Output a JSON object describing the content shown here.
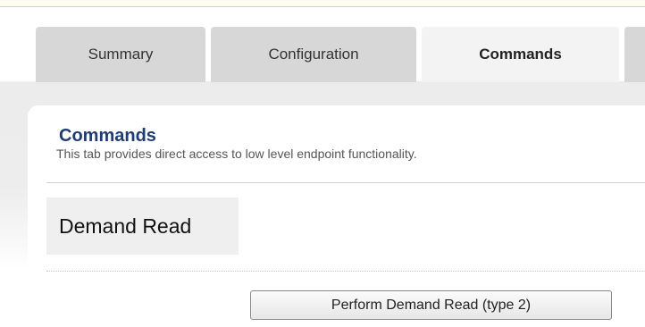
{
  "tabs": {
    "items": [
      {
        "label": "Summary"
      },
      {
        "label": "Configuration"
      },
      {
        "label": "Commands"
      },
      {
        "label": ""
      }
    ],
    "active": "Commands"
  },
  "commands": {
    "title": "Commands",
    "description": "This tab provides direct access to low level endpoint functionality.",
    "demand_read": {
      "heading": "Demand Read",
      "button_label": "Perform Demand Read (type 2)"
    }
  },
  "colors": {
    "accent_title": "#1f3d73",
    "notice_border": "#f4d65a",
    "inactive_tab": "#d7d7d7",
    "active_tab": "#f3f3f3"
  }
}
